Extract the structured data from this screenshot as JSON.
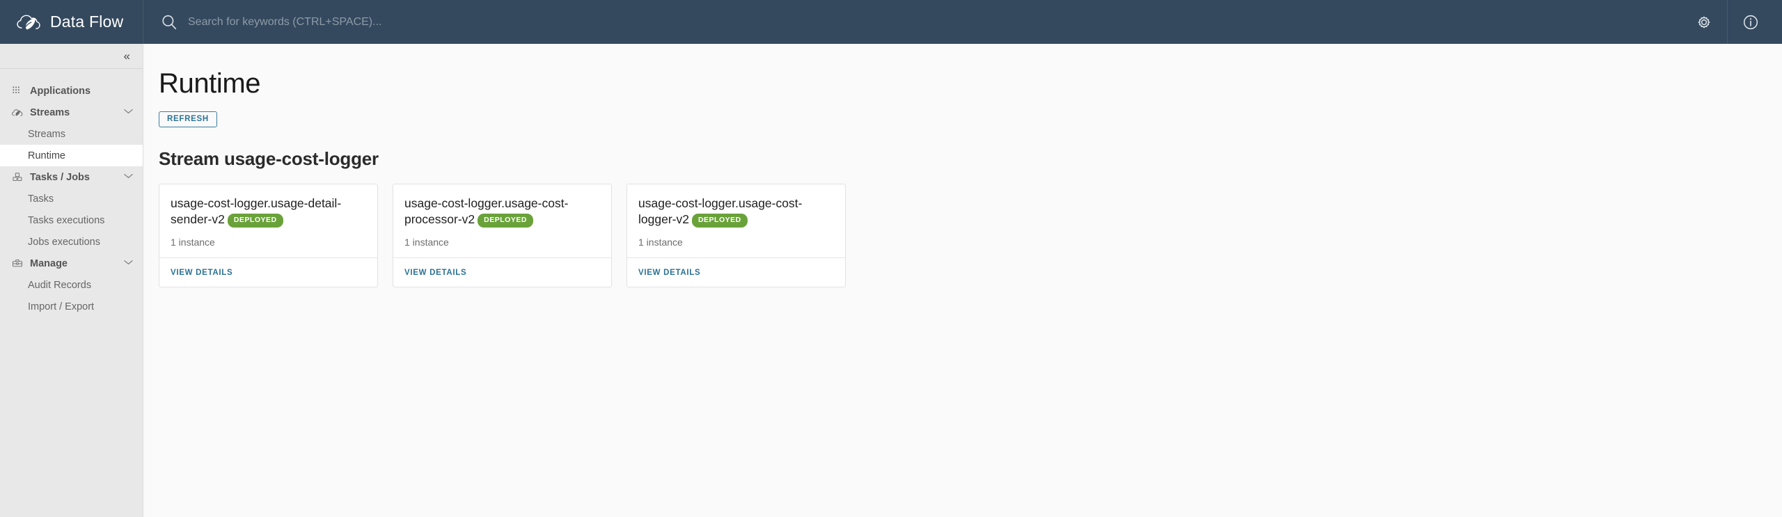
{
  "header": {
    "brand_title": "Data Flow",
    "logo_icon": "spring-cloud-leaf-logo",
    "search": {
      "icon": "search-icon",
      "value": "",
      "placeholder": "Search for keywords (CTRL+SPACE)..."
    },
    "actions": [
      {
        "icon": "gear-icon",
        "name": "settings-button"
      },
      {
        "icon": "info-circle-icon",
        "name": "about-button"
      }
    ]
  },
  "sidebar": {
    "collapse_icon": "«",
    "groups": [
      {
        "label": "Applications",
        "icon": "grid-dots-icon",
        "has_chevron": false,
        "items": []
      },
      {
        "label": "Streams",
        "icon": "cloud-leaf-icon",
        "has_chevron": true,
        "chevron": "⌄",
        "items": [
          {
            "label": "Streams",
            "active": false
          },
          {
            "label": "Runtime",
            "active": true
          }
        ]
      },
      {
        "label": "Tasks / Jobs",
        "icon": "boxes-icon",
        "has_chevron": true,
        "chevron": "⌄",
        "items": [
          {
            "label": "Tasks",
            "active": false
          },
          {
            "label": "Tasks executions",
            "active": false
          },
          {
            "label": "Jobs executions",
            "active": false
          }
        ]
      },
      {
        "label": "Manage",
        "icon": "briefcase-icon",
        "has_chevron": true,
        "chevron": "⌄",
        "items": [
          {
            "label": "Audit Records",
            "active": false
          },
          {
            "label": "Import / Export",
            "active": false
          }
        ]
      }
    ]
  },
  "main": {
    "page_title": "Runtime",
    "refresh_label": "REFRESH",
    "section_title": "Stream usage-cost-logger",
    "view_details_label": "VIEW DETAILS",
    "cards": [
      {
        "name": "usage-cost-logger.usage-detail-sender-v2",
        "status": "DEPLOYED",
        "instances": "1 instance"
      },
      {
        "name": "usage-cost-logger.usage-cost-processor-v2",
        "status": "DEPLOYED",
        "instances": "1 instance"
      },
      {
        "name": "usage-cost-logger.usage-cost-logger-v2",
        "status": "DEPLOYED",
        "instances": "1 instance"
      }
    ]
  },
  "colors": {
    "header_bg": "#34495e",
    "sidebar_bg": "#e8e8e8",
    "main_bg": "#fafafa",
    "link_blue": "#2b7294",
    "badge_green": "#6aa23a"
  }
}
